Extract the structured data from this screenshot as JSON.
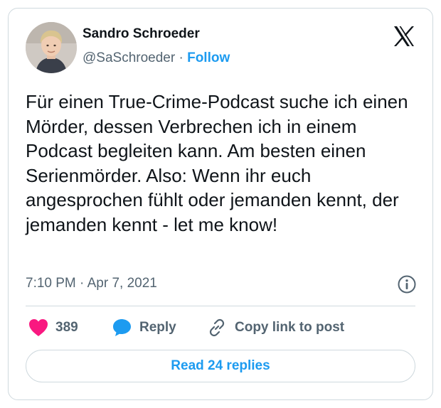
{
  "author": {
    "name": "Sandro Schroeder",
    "handle": "@SaSchroeder",
    "separator": "·",
    "follow_label": "Follow"
  },
  "tweet": {
    "text": "Für einen True-Crime-Podcast suche ich einen Mörder, dessen Verbrechen ich in einem Podcast begleiten kann. Am besten einen Serienmörder. Also: Wenn ihr euch angesprochen fühlt oder jemanden kennt, der jemanden kennt - let me know!",
    "timestamp": "7:10 PM · Apr 7, 2021"
  },
  "actions": {
    "like_count": "389",
    "reply_label": "Reply",
    "copy_link_label": "Copy link to post"
  },
  "read_replies_label": "Read 24 replies",
  "icons": {
    "platform": "x-logo-icon",
    "info": "info-icon",
    "like": "heart-icon",
    "reply": "speech-bubble-icon",
    "copy": "link-icon"
  },
  "colors": {
    "accent": "#1d9bf0",
    "like": "#f91880",
    "text": "#0f1419",
    "secondary": "#536471",
    "border": "#cfd9de"
  }
}
